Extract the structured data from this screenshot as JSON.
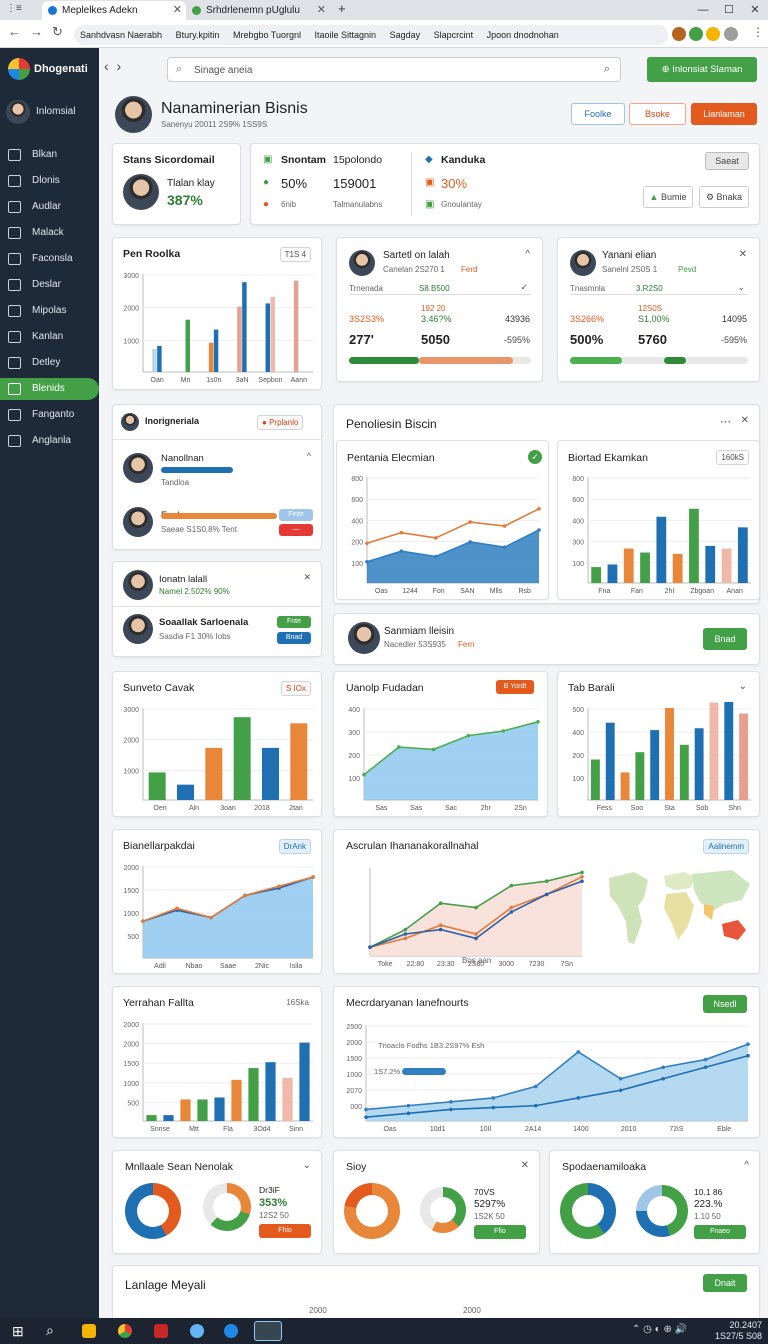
{
  "browser": {
    "tabs": [
      {
        "label": "Meplelkes Adekn",
        "color": "#1976d2"
      },
      {
        "label": "Srhdrlenemn pUglulu",
        "color": "#43a047"
      }
    ],
    "bookmarks": [
      "Sanhdvasn Naerabh",
      "Btury.kpitin",
      "Mrebgbo Tuorgnl",
      "Itaoile Sittagnin",
      "Sagday",
      "Slapcrcint",
      "Jpoon dnodnohan"
    ]
  },
  "sidebar": {
    "logo": "Dhogenati",
    "user": "Inlomsial",
    "items": [
      "Blkan",
      "Dlonis",
      "Audlar",
      "Malack",
      "Faconsla",
      "Deslar",
      "Mipolas",
      "Kanlan",
      "Detley",
      "Blenids",
      "Fanganto",
      "Anglanla"
    ],
    "active_index": 9
  },
  "search": {
    "placeholder": "Sinage aneia",
    "action_label": "Inlonsiat Slaman"
  },
  "header": {
    "title": "Nanaminerian Bisnis",
    "subtitle": "Sanenyu 20011 2S9% 1SS9S",
    "btn1": "Foolke",
    "btn2": "Bsoke",
    "btn3": "Lianlaman"
  },
  "summary": {
    "card1_title": "Stans Sicordomail",
    "person": "Tlalan klay",
    "pct": "387%",
    "col2_title": "Snontam",
    "col2_a": "50%",
    "col2_b": "6nib",
    "col3_title": "15polondo",
    "col3_a": "159001",
    "col3_b": "Talmanulabns",
    "col4_title": "Kanduka",
    "col4_a": "30%",
    "col4_b": "Gnoulantay",
    "chip": "Saeat",
    "btn_a": "Bumie",
    "btn_b": "Bnaka"
  },
  "row2": {
    "left_title": "Pen Roolka",
    "left_chip": "T1S 4",
    "mid_name": "Sartetl on lalah",
    "mid_sub": "Canelan 2S270 1",
    "mid_tag": "Ferd",
    "mid_l1": "Trnenada",
    "mid_l2": "S8.B500",
    "mid_p1": "3S2S3%",
    "mid_p2": "3.46?%",
    "mid_p3": "43936",
    "mid_small": "192 20",
    "mid_v1": "277'",
    "mid_v2": "5050",
    "mid_v3": "-595%",
    "right_name": "Yanani elian",
    "right_sub": "Sanelnl 2S0S 1",
    "right_tag": "Pevd",
    "right_l1": "Tnasmnla",
    "right_l2": "3.R2S0",
    "right_p1": "3S266%",
    "right_p2": "S1,00%",
    "right_p3": "14095",
    "right_small": "12S0S",
    "right_v1": "500%",
    "right_v2": "5760",
    "right_v3": "-595%"
  },
  "people": {
    "title": "Inorigneriala",
    "tag": "Prplanlo",
    "p1": "Nanollnan",
    "p1_sub": "Tandloa",
    "p2": "Foolne",
    "p2_sub": "Saeae S1S0.8% Tent",
    "p2_btn": "Finte",
    "p3": "Ionatn lalall",
    "p3_sub": "Namel 2.502% 90%",
    "p4": "Soaallak Sarloenala",
    "p4_sub": "Sasdia F1 30% Iobs",
    "p4_btn1": "Fnte",
    "p4_btn2": "Bnad"
  },
  "bisnis": {
    "title": "Penoliesin Biscin",
    "chart1_title": "Pentania Elecmian",
    "chart2_title": "Biortad Ekamkan",
    "chart2_chip": "160kS"
  },
  "person_card": {
    "name": "Sanmiam lleisin",
    "sub": "Nacedler 53S935",
    "tag": "Fern",
    "btn": "Bnad"
  },
  "row4": {
    "a_title": "Sunveto Cavak",
    "a_chip": "S IOx",
    "b_title": "Uanolp Fudadan",
    "b_chip": "B Yordt",
    "c_title": "Tab Barali"
  },
  "row5": {
    "a_title": "Bianellarpakdai",
    "a_chip": "DrAnk",
    "b_title": "Ascrulan Ihananakorallnahal",
    "b_chip": "Aalinemm",
    "b_xlabel": "Bos aan"
  },
  "row6": {
    "a_title": "Yerrahan Fallta",
    "a_chip": "16Ska",
    "b_title": "Mecrdaryanan Ianefnourts",
    "b_btn": "Nsedl",
    "b_annot1": "Tnoaclo Fodhs 1B3.2S97% Esh",
    "b_annot2": "1S7.2%"
  },
  "donuts": {
    "a_title": "Mnllaale Sean Nenolak",
    "a_l1": "Dr3iF",
    "a_l2": "353%",
    "a_l3": "12S2 50",
    "a_btn": "Fhio",
    "b_title": "Sioy",
    "b_l1": "70VS",
    "b_l2": "5297%",
    "b_l3": "1S2K 50",
    "b_btn": "Ffio",
    "c_title": "Spodaenamiloaka",
    "c_l1": "10.1 86",
    "c_l2": "223.%",
    "c_l3": "1.10 50",
    "c_btn": "Fnaeo"
  },
  "bottom": {
    "title": "Lanlage Meyali",
    "btn": "Dnait",
    "ticks": [
      "2000",
      "2000"
    ]
  },
  "taskbar": {
    "clock1": "20.2407",
    "clock2": "1S27/5 S08"
  },
  "chart_data": [
    {
      "id": "pen_roolka",
      "type": "bar",
      "categories": [
        "Oan",
        "Mn",
        "1s0n",
        "3aN",
        "Sepbon",
        "Aann"
      ],
      "y_ticks": [
        "3000",
        "2000",
        "1000"
      ],
      "ylim": [
        0,
        3000
      ],
      "series": [
        {
          "color": "#b9d4ea",
          "values": [
            700,
            0,
            0,
            0,
            0,
            0
          ]
        },
        {
          "color": "#1f6fb3",
          "values": [
            800,
            0,
            1300,
            0,
            1600,
            0
          ]
        },
        {
          "color": "#e8863a",
          "values": [
            0,
            0,
            900,
            0,
            0,
            0
          ]
        },
        {
          "color": "#43a047",
          "values": [
            0,
            1600,
            0,
            0,
            0,
            0
          ]
        },
        {
          "color": "#e6a090",
          "values": [
            0,
            0,
            0,
            2000,
            0,
            2800
          ]
        },
        {
          "color": "#1f6fb3",
          "values": [
            0,
            0,
            0,
            2750,
            0,
            0
          ]
        },
        {
          "color": "#1f6fb3",
          "values": [
            0,
            0,
            0,
            0,
            2100,
            0
          ]
        },
        {
          "color": "#f0b8a8",
          "values": [
            0,
            0,
            0,
            0,
            2300,
            0
          ]
        }
      ]
    },
    {
      "id": "pentania",
      "type": "area",
      "x": [
        "Oas",
        "1244",
        "Fon",
        "SAN",
        "Mlls",
        "Rsb"
      ],
      "y_ticks": [
        "800",
        "600",
        "400",
        "200",
        "100"
      ],
      "ylim": [
        0,
        800
      ],
      "series": [
        {
          "name": "",
          "color": "#2f7fc1",
          "values": [
            160,
            240,
            200,
            310,
            270,
            400
          ]
        },
        {
          "name": "",
          "color": "#e07b39",
          "values": [
            300,
            380,
            340,
            460,
            430,
            560
          ]
        }
      ]
    },
    {
      "id": "biortad",
      "type": "bar",
      "categories": [
        "Fna",
        "Fan",
        "2hI",
        "Zbgoan",
        "Anan"
      ],
      "y_ticks": [
        "800",
        "600",
        "400",
        "300",
        "100"
      ],
      "ylim": [
        0,
        800
      ],
      "values": [
        120,
        140,
        260,
        230,
        500,
        220,
        560,
        280,
        260,
        420
      ]
    },
    {
      "id": "sunveto",
      "type": "bar",
      "categories": [
        "Oen",
        "Aln",
        "3oan",
        "2018",
        "2tan"
      ],
      "y_ticks": [
        "3000",
        "2000",
        "1000"
      ],
      "ylim": [
        0,
        3000
      ],
      "values": [
        900,
        500,
        1700,
        2700,
        1700,
        2500
      ]
    },
    {
      "id": "uanolp",
      "type": "area",
      "x": [
        "Sas",
        "Sas",
        "Sac",
        "2hr",
        "2Sn"
      ],
      "y_ticks": [
        "400",
        "300",
        "200",
        "100"
      ],
      "ylim": [
        0,
        400
      ],
      "series": [
        {
          "color": "#4caf50",
          "values": [
            110,
            230,
            220,
            280,
            300,
            340
          ]
        }
      ]
    },
    {
      "id": "tab_barali",
      "type": "bar",
      "categories": [
        "Fess",
        "Soo",
        "Sta",
        "Sob",
        "Shn"
      ],
      "y_ticks": [
        "500",
        "400",
        "200",
        "100"
      ],
      "ylim": [
        0,
        500
      ],
      "values": [
        220,
        420,
        150,
        260,
        380,
        500,
        300,
        390,
        530,
        590,
        470
      ]
    },
    {
      "id": "bianellar",
      "type": "area",
      "x": [
        "Adil",
        "Nbao",
        "Saae",
        "2Nic",
        "Isila"
      ],
      "y_ticks": [
        "2000",
        "1500",
        "1000",
        "500"
      ],
      "ylim": [
        0,
        2500
      ],
      "series": [
        {
          "color": "#2962a8",
          "values": [
            1000,
            1300,
            1100,
            1700,
            1900,
            2200
          ]
        },
        {
          "color": "#e07b39",
          "values": [
            1000,
            1350,
            1100,
            1700,
            1950,
            2200
          ]
        }
      ]
    },
    {
      "id": "ascrulan",
      "type": "line",
      "x": [
        "Toke",
        "22:80",
        "23:30",
        "2S80",
        "3000",
        "7230",
        "7Sn"
      ],
      "ylim": [
        0,
        100
      ],
      "series": [
        {
          "color": "#43a047",
          "values": [
            10,
            30,
            60,
            55,
            80,
            85,
            95
          ]
        },
        {
          "color": "#e07b39",
          "values": [
            10,
            20,
            35,
            25,
            55,
            70,
            90
          ]
        },
        {
          "color": "#2962a8",
          "values": [
            10,
            25,
            30,
            20,
            50,
            70,
            85
          ]
        }
      ]
    },
    {
      "id": "yerrahan",
      "type": "bar",
      "categories": [
        "Snnse",
        "Mtt",
        "Fla",
        "3Od4",
        "Sinn"
      ],
      "y_ticks": [
        "2000",
        "2000",
        "1500",
        "1000",
        "500"
      ],
      "ylim": [
        0,
        2500
      ],
      "values": [
        150,
        150,
        550,
        550,
        600,
        1050,
        1350,
        1500,
        1100,
        2000
      ]
    },
    {
      "id": "mecrdaryanan",
      "type": "area",
      "x": [
        "Oas",
        "10d1",
        "10Il",
        "2A14",
        "1400",
        "2010",
        "72iS",
        "Eble"
      ],
      "y_ticks": [
        "2500",
        "2000",
        "1500",
        "1000",
        "2070",
        "000"
      ],
      "ylim": [
        0,
        2500
      ],
      "series": [
        {
          "color": "#2f7fc1",
          "values": [
            300,
            400,
            500,
            600,
            900,
            1800,
            1100,
            1400,
            1600,
            2000
          ]
        },
        {
          "color": "#1f6fb3",
          "values": [
            100,
            200,
            300,
            350,
            400,
            600,
            800,
            1100,
            1400,
            1700
          ]
        }
      ]
    }
  ]
}
